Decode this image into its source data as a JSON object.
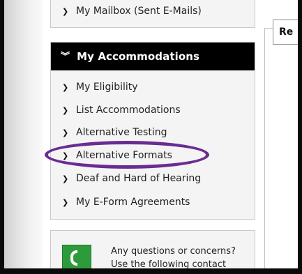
{
  "mailbox": {
    "label": "My Mailbox (Sent E-Mails)"
  },
  "accommodations": {
    "header": "My Accommodations",
    "items": [
      {
        "label": "My Eligibility"
      },
      {
        "label": "List Accommodations"
      },
      {
        "label": "Alternative Testing"
      },
      {
        "label": "Alternative Formats"
      },
      {
        "label": "Deaf and Hard of Hearing"
      },
      {
        "label": "My E-Form Agreements"
      }
    ]
  },
  "help": {
    "line1": "Any questions or concerns?",
    "line2": "Use the following contact"
  },
  "tab": {
    "label": "Re"
  },
  "highlight": {
    "color": "#6a2c91"
  },
  "icons": {
    "chevron": "chevron-right-icon",
    "double_chevron": "double-chevron-down-icon",
    "phone": "phone-icon"
  }
}
